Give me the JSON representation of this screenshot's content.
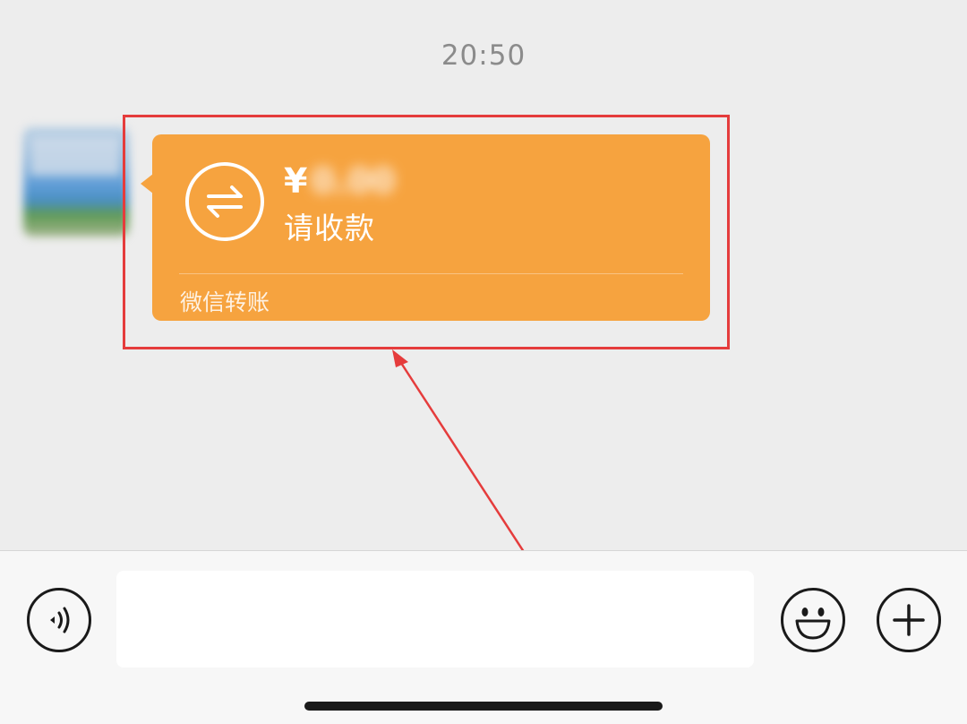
{
  "chat": {
    "timestamp": "20:50",
    "message": {
      "currency_symbol": "¥",
      "amount_hidden": "0.00",
      "request_label": "请收款",
      "footer_label": "微信转账",
      "bubble_color": "#f6a33f"
    }
  },
  "annotation": {
    "box_color": "#e53c3c"
  },
  "input_bar": {
    "voice_icon": "voice-icon",
    "emoji_icon": "emoji-icon",
    "plus_icon": "plus-icon",
    "input_value": ""
  }
}
